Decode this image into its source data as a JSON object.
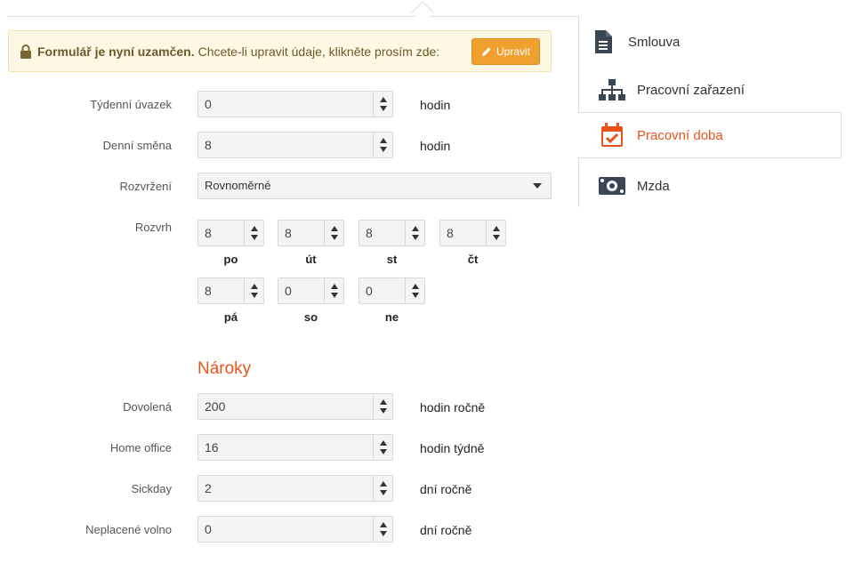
{
  "alert": {
    "bold": "Formulář je nyní uzamčen.",
    "text": "Chcete-li upravit údaje, klikněte prosím zde:",
    "button": "Upravit"
  },
  "fields": {
    "weekly": {
      "label": "Týdenní úvazek",
      "value": "0",
      "unit": "hodin"
    },
    "daily": {
      "label": "Denní směna",
      "value": "8",
      "unit": "hodin"
    },
    "distribution": {
      "label": "Rozvržení",
      "value": "Rovnoměrné"
    },
    "schedule": {
      "label": "Rozvrh"
    }
  },
  "days": [
    {
      "name": "po",
      "value": "8"
    },
    {
      "name": "út",
      "value": "8"
    },
    {
      "name": "st",
      "value": "8"
    },
    {
      "name": "čt",
      "value": "8"
    },
    {
      "name": "pá",
      "value": "8"
    },
    {
      "name": "so",
      "value": "0"
    },
    {
      "name": "ne",
      "value": "0"
    }
  ],
  "claims": {
    "title": "Nároky",
    "vacation": {
      "label": "Dovolená",
      "value": "200",
      "unit": "hodin ročně"
    },
    "home_office": {
      "label": "Home office",
      "value": "16",
      "unit": "hodin týdně"
    },
    "sickday": {
      "label": "Sickday",
      "value": "2",
      "unit": "dní ročně"
    },
    "unpaid": {
      "label": "Neplacené volno",
      "value": "0",
      "unit": "dní ročně"
    }
  },
  "nav": [
    {
      "label": "Smlouva",
      "icon": "document-icon"
    },
    {
      "label": "Pracovní zařazení",
      "icon": "org-chart-icon"
    },
    {
      "label": "Pracovní doba",
      "icon": "calendar-check-icon",
      "active": true
    },
    {
      "label": "Mzda",
      "icon": "money-icon"
    }
  ],
  "colors": {
    "accent": "#e8531c",
    "button": "#f0a030",
    "alert_bg": "#fcf8e3"
  }
}
